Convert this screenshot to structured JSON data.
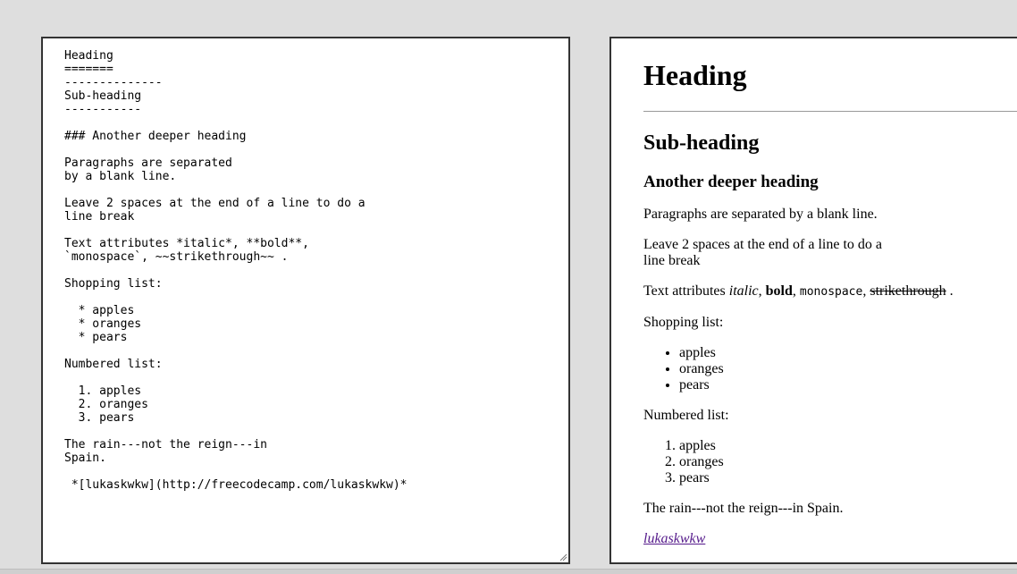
{
  "editor": {
    "text": "Heading\n=======\n--------------\nSub-heading\n-----------\n\n### Another deeper heading\n\nParagraphs are separated\nby a blank line.\n\nLeave 2 spaces at the end of a line to do a\nline break\n\nText attributes *italic*, **bold**,\n`monospace`, ~~strikethrough~~ .\n\nShopping list:\n\n  * apples\n  * oranges\n  * pears\n\nNumbered list:\n\n  1. apples\n  2. oranges\n  3. pears\n\nThe rain---not the reign---in\nSpain.\n\n *[lukaskwkw](http://freecodecamp.com/lukaskwkw)*"
  },
  "preview": {
    "h1": "Heading",
    "h2": "Sub-heading",
    "h3": "Another deeper heading",
    "p_paragraphs": "Paragraphs are separated by a blank line.",
    "p_linebreak_line1": "Leave 2 spaces at the end of a line to do a",
    "p_linebreak_line2": "line break",
    "attrs": {
      "prefix": "Text attributes ",
      "italic": "italic",
      "sep1": ", ",
      "bold": "bold",
      "sep2": ", ",
      "mono": "monospace",
      "sep3": ", ",
      "strike": "strikethrough",
      "suffix": " ."
    },
    "shopping_label": "Shopping list:",
    "shopping_items": [
      "apples",
      "oranges",
      "pears"
    ],
    "numbered_label": "Numbered list:",
    "numbered_items": [
      "apples",
      "oranges",
      "pears"
    ],
    "rain": "The rain---not the reign---in Spain.",
    "link_text": "lukaskwkw",
    "link_href": "http://freecodecamp.com/lukaskwkw"
  }
}
